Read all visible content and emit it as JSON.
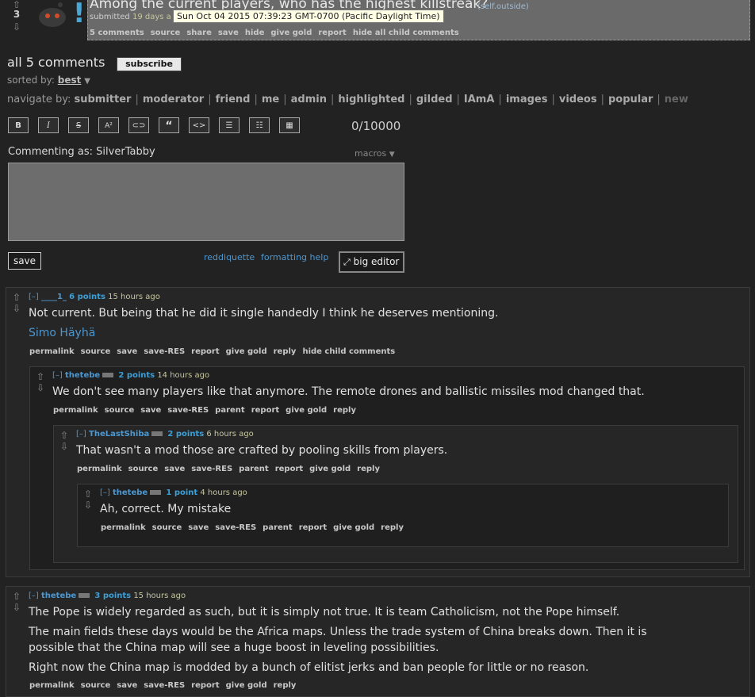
{
  "post": {
    "score": "3",
    "self_marker": "!",
    "title": "Among the current players, who has the highest killstreak?",
    "domain": "(self.outside)",
    "submitted_prefix": "submitted",
    "submitted_time": "19 days a",
    "tooltip": "Sun Oct 04 2015 07:39:23 GMT-0700 (Pacific Daylight Time)",
    "buttons": [
      "5 comments",
      "source",
      "share",
      "save",
      "hide",
      "give gold",
      "report",
      "hide all child comments"
    ]
  },
  "comments_header": {
    "title": "all 5 comments",
    "subscribe": "subscribe",
    "sorted_label": "sorted by:",
    "sorted_value": "best"
  },
  "navigate": {
    "label": "navigate by:",
    "items": [
      "submitter",
      "moderator",
      "friend",
      "me",
      "admin",
      "highlighted",
      "gilded",
      "IAmA",
      "images",
      "videos",
      "popular",
      "new"
    ]
  },
  "editor": {
    "toolbar": [
      "B",
      "I",
      "S",
      "A²",
      "link",
      "quote",
      "code",
      "bullets",
      "numbers",
      "table"
    ],
    "char_count": "0/10000",
    "commenting_as": "Commenting as: SilverTabby",
    "macros": "macros",
    "save": "save",
    "reddiquette": "reddiquette",
    "formatting_help": "formatting help",
    "big_editor": "big editor"
  },
  "comments": [
    {
      "toggle": "[–]",
      "author": "____1_",
      "points": "6 points",
      "time": "15 hours ago",
      "body": [
        "Not current. But being that he did it single handedly I think he deserves mentioning."
      ],
      "link": "Simo Häyhä",
      "buttons": [
        "permalink",
        "source",
        "save",
        "save-RES",
        "report",
        "give gold",
        "reply",
        "hide child comments"
      ]
    },
    {
      "toggle": "[–]",
      "author": "thetebe",
      "points": "2 points",
      "time": "14 hours ago",
      "body": [
        "We don't see many players like that anymore. The remote drones and ballistic missiles mod changed that."
      ],
      "buttons": [
        "permalink",
        "source",
        "save",
        "save-RES",
        "parent",
        "report",
        "give gold",
        "reply"
      ]
    },
    {
      "toggle": "[–]",
      "author": "TheLastShiba",
      "points": "2 points",
      "time": "6 hours ago",
      "body": [
        "That wasn't a mod those are crafted by pooling skills from players."
      ],
      "buttons": [
        "permalink",
        "source",
        "save",
        "save-RES",
        "parent",
        "report",
        "give gold",
        "reply"
      ]
    },
    {
      "toggle": "[–]",
      "author": "thetebe",
      "points": "1 point",
      "time": "4 hours ago",
      "body": [
        "Ah, correct. My mistake"
      ],
      "buttons": [
        "permalink",
        "source",
        "save",
        "save-RES",
        "parent",
        "report",
        "give gold",
        "reply"
      ]
    },
    {
      "toggle": "[–]",
      "author": "thetebe",
      "points": "3 points",
      "time": "15 hours ago",
      "body": [
        "The Pope is widely regarded as such, but it is simply not true. It is team Catholicism, not the Pope himself.",
        "The main fields these days would be the Africa maps. Unless the trade system of China breaks down. Then it is",
        "possible that the China map will see a huge boost in leveling possibilities.",
        "Right now the China map is modded by a bunch of elitist jerks and ban people for little or no reason."
      ],
      "buttons": [
        "permalink",
        "source",
        "save",
        "save-RES",
        "report",
        "give gold",
        "reply"
      ]
    }
  ]
}
